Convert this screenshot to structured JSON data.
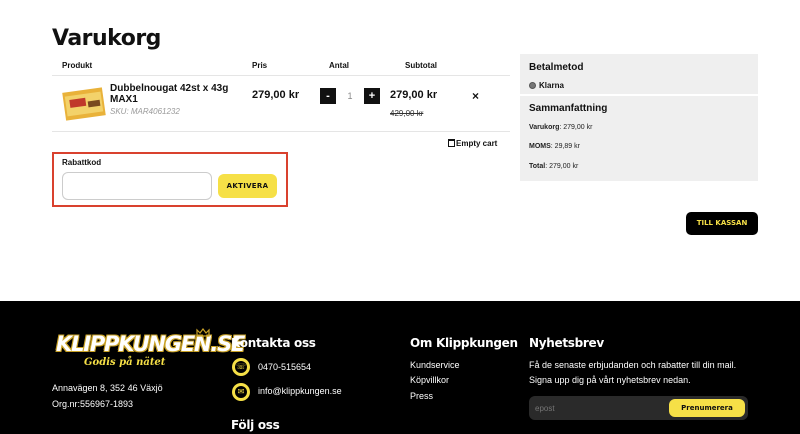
{
  "page": {
    "title": "Varukorg"
  },
  "cart": {
    "headers": {
      "product": "Produkt",
      "price": "Pris",
      "qty": "Antal",
      "subtotal": "Subtotal"
    },
    "item": {
      "name": "Dubbelnougat 42st x 43g MAX1",
      "sku": "SKU: MAR4061232",
      "price": "279,00 kr",
      "qty_minus": "-",
      "qty": "1",
      "qty_plus": "+",
      "subtotal": "279,00 kr",
      "subtotal_old": "429,00 kr",
      "remove": "×"
    },
    "empty_cart": "Empty cart"
  },
  "coupon": {
    "label": "Rabattkod",
    "placeholder": "",
    "button": "AKTIVERA"
  },
  "summary": {
    "payment_heading": "Betalmetod",
    "payment_method": "Klarna",
    "summary_heading": "Sammanfattning",
    "lines": [
      {
        "label": "Varukorg",
        "value": ": 279,00 kr"
      },
      {
        "label": "MOMS",
        "value": ": 29,89 kr"
      },
      {
        "label": "Total",
        "value": ": 279,00 kr"
      }
    ]
  },
  "checkout": {
    "button": "TILL KASSAN"
  },
  "footer": {
    "logo": {
      "main": "KLIPPKUNGEN.SE",
      "tagline": "Godis på nätet"
    },
    "address": "Annavägen 8, 352 46 Växjö",
    "org": "Org.nr:556967-1893",
    "contact": {
      "heading": "Kontakta oss",
      "phone": "0470-515654",
      "email": "info@klippkungen.se",
      "follow": "Följ oss"
    },
    "about": {
      "heading": "Om Klippkungen",
      "links": [
        "Kundservice",
        "Köpvillkor",
        "Press"
      ]
    },
    "newsletter": {
      "heading": "Nyhetsbrev",
      "text": "Få de senaste erbjudanden och rabatter till din mail. Signa upp dig på vårt nyhetsbrev nedan.",
      "placeholder": "epost",
      "button": "Prenumerera"
    }
  },
  "colors": {
    "accent": "#f6e047",
    "highlight_border": "#d9412e",
    "footer_bg": "#000000",
    "panel_bg": "#efefef"
  }
}
